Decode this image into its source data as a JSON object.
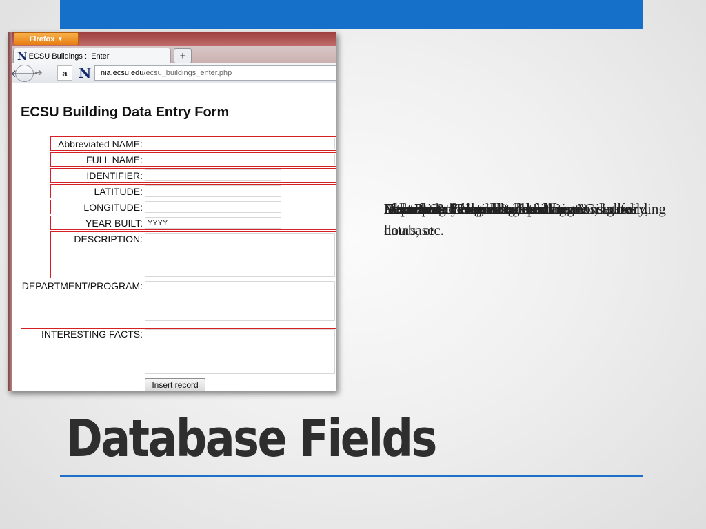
{
  "slide": {
    "title": "Database Fields",
    "bullet_lines": [
      "Abbreviated Name: “abbreviation” used for database",
      "Full name: the building’s full name",
      "Identifier: the building identifier",
      "Latitude & Longitude: building coordinates",
      "Year Built: year constructed",
      "Description: facts about building",
      "Department/Program: department using building",
      "Interesting Facts: details such as AC, laundry, hours, etc."
    ]
  },
  "browser": {
    "menu_button": "Firefox",
    "tab_title": "ECSU Buildings :: Enter",
    "new_tab": "+",
    "url_host": "nia.ecsu.edu",
    "url_path": "/ecsu_buildings_enter.php",
    "site_logo": "N",
    "amazon_logo": "a"
  },
  "form": {
    "title": "ECSU Building Data Entry Form",
    "fields": [
      {
        "label": "Abbreviated NAME:",
        "value": ""
      },
      {
        "label": "FULL NAME:",
        "value": ""
      },
      {
        "label": "IDENTIFIER:",
        "value": ""
      },
      {
        "label": "LATITUDE:",
        "value": ""
      },
      {
        "label": "LONGITUDE:",
        "value": ""
      },
      {
        "label": "YEAR BUILT:",
        "value": "YYYY"
      },
      {
        "label": "DESCRIPTION:",
        "value": ""
      },
      {
        "label": "DEPARTMENT/PROGRAM:",
        "value": ""
      },
      {
        "label": "INTERESTING FACTS:",
        "value": ""
      }
    ],
    "submit_label": "Insert record"
  },
  "colors": {
    "accent_blue": "#1470c8",
    "highlight_red": "#d71f26"
  },
  "icons": {
    "back": "back-arrow-icon",
    "forward": "forward-arrow-icon",
    "menu": "chevron-down-icon"
  }
}
